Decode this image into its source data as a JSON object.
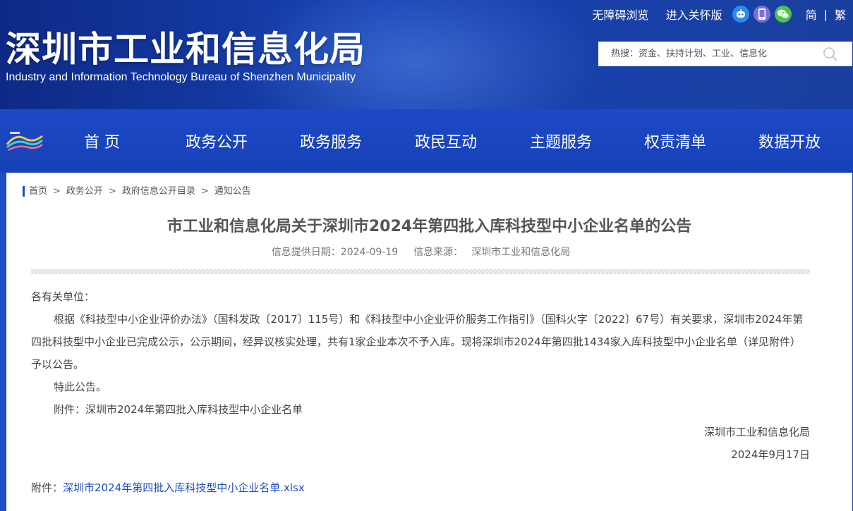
{
  "header": {
    "title": "深圳市工业和信息化局",
    "subtitle": "Industry and Information Technology Bureau of Shenzhen Municipality",
    "accessibility_link": "无障碍浏览",
    "elder_link": "进入关怀版",
    "lang_simplified": "简",
    "lang_separator": "|",
    "lang_traditional": "繁",
    "search_placeholder": "热搜：资金、扶持计划、工业、信息化"
  },
  "nav": {
    "items": [
      "首 页",
      "政务公开",
      "政务服务",
      "政民互动",
      "主题服务",
      "权责清单",
      "数据开放"
    ]
  },
  "breadcrumb": {
    "items": [
      "首页",
      "政务公开",
      "政府信息公开目录",
      "通知公告"
    ],
    "separator": ">"
  },
  "article": {
    "title": "市工业和信息化局关于深圳市2024年第四批入库科技型中小企业名单的公告",
    "date_label": "信息提供日期：2024-09-19",
    "source_label": "信息来源：",
    "source": "深圳市工业和信息化局",
    "salutation": "各有关单位：",
    "paragraph": "根据《科技型中小企业评价办法》（国科发政〔2017〕115号）和《科技型中小企业评价服务工作指引》（国科火字〔2022〕67号）有关要求，深圳市2024年第四批科技型中小企业已完成公示，公示期间，经异议核实处理，共有1家企业本次不予入库。现将深圳市2024年第四批1434家入库科技型中小企业名单（详见附件）予以公告。",
    "notice": "特此公告。",
    "attachment_note": "附件：深圳市2024年第四批入库科技型中小企业名单",
    "signature_org": "深圳市工业和信息化局",
    "signature_date": "2024年9月17日",
    "attachment_label": "附件：",
    "attachment_file": "深圳市2024年第四批入库科技型中小企业名单.xlsx"
  },
  "colors": {
    "brand_blue": "#1f4cc0",
    "link_blue": "#1f4cc0"
  },
  "icons": [
    "robot-icon",
    "mobile-icon",
    "wechat-icon",
    "search-icon",
    "site-logo"
  ]
}
